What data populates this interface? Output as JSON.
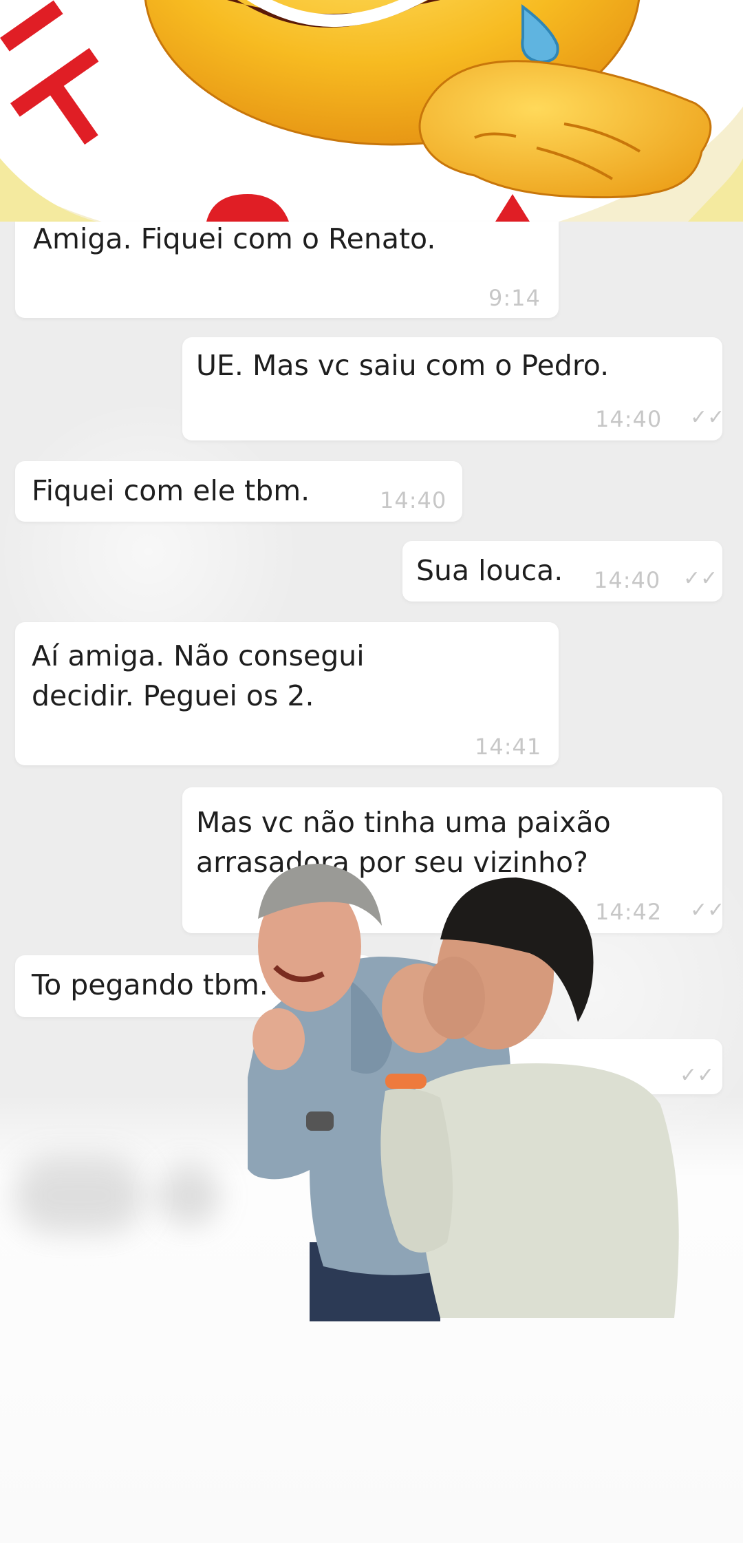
{
  "banner": {
    "icon": "laughing-crying-emoji-icon",
    "sticker_text": "HU"
  },
  "messages": [
    {
      "side": "in",
      "text": "Amiga. Fiquei com o Renato.",
      "time": "9:14"
    },
    {
      "side": "out",
      "text": "UE. Mas vc saiu com o Pedro.",
      "time": "14:40"
    },
    {
      "side": "in",
      "text": "Fiquei com ele tbm.",
      "time": "14:40"
    },
    {
      "side": "out",
      "text": "Sua louca.",
      "time": "14:40"
    },
    {
      "side": "in",
      "text_lines": [
        "Aí amiga. Não consegui",
        "decidir. Peguei os 2."
      ],
      "time": "14:41"
    },
    {
      "side": "out",
      "text_lines": [
        "Mas vc não tinha uma paixão",
        "arrasadora por seu vizinho?"
      ],
      "time": "14:42"
    },
    {
      "side": "in",
      "text": "To pegando tbm.",
      "time": ""
    },
    {
      "side": "out",
      "text": "",
      "time": ""
    }
  ],
  "overlay": {
    "icon": "laughing-men-photo"
  },
  "colors": {
    "bubble": "#ffffff",
    "background": "#ededed",
    "emoji": "#f5b120",
    "sticker_red": "#e01e25"
  }
}
